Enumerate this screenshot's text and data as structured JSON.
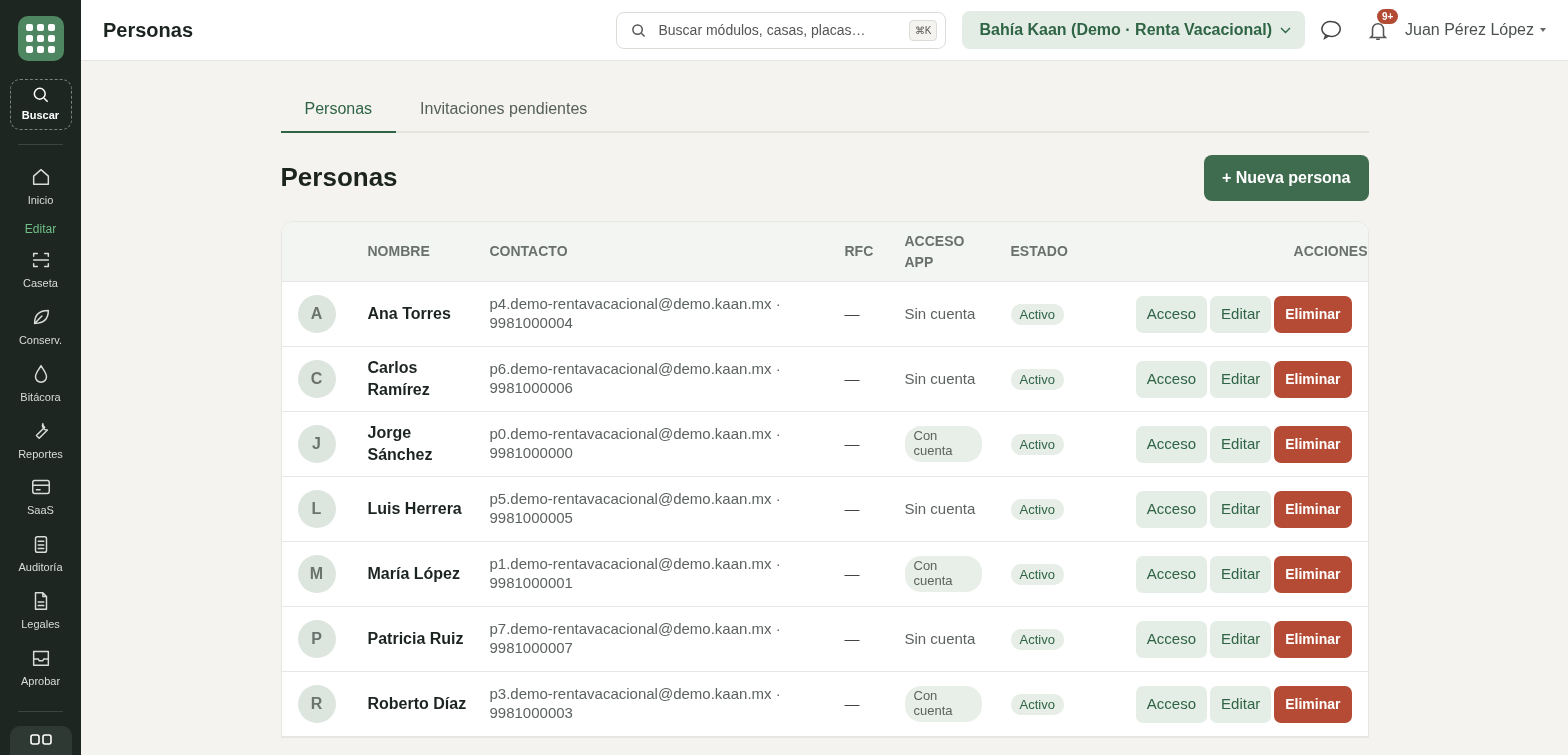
{
  "header": {
    "title": "Personas",
    "search": {
      "placeholder": "Buscar módulos, casas, placas…",
      "shortcut": "⌘K"
    },
    "workspace": "Bahía Kaan (Demo · Renta Vacacional)",
    "notifications": "9+",
    "user": "Juan Pérez López"
  },
  "sidebar": {
    "items": [
      {
        "kind": "search",
        "label": "Buscar",
        "selected": true
      },
      {
        "kind": "divider"
      },
      {
        "kind": "item",
        "label": "Inicio",
        "selected": false
      },
      {
        "kind": "section",
        "label": "Editar"
      },
      {
        "kind": "item",
        "label": "Caseta",
        "selected": false
      },
      {
        "kind": "item",
        "label": "Conserv.",
        "selected": false
      },
      {
        "kind": "item",
        "label": "Bitácora",
        "selected": false
      },
      {
        "kind": "item",
        "label": "Reportes",
        "selected": false
      },
      {
        "kind": "item",
        "label": "SaaS",
        "selected": false
      },
      {
        "kind": "item",
        "label": "Auditoría",
        "selected": false
      },
      {
        "kind": "item",
        "label": "Legales",
        "selected": false
      },
      {
        "kind": "item",
        "label": "Aprobar",
        "selected": false
      },
      {
        "kind": "divider"
      },
      {
        "kind": "more"
      }
    ]
  },
  "tabs": [
    {
      "label": "Personas",
      "selected": true
    },
    {
      "label": "Invitaciones pendientes",
      "selected": false
    }
  ],
  "page_title": "Personas",
  "new_button": "+ Nueva persona",
  "table": {
    "columns": [
      "",
      "NOMBRE",
      "CONTACTO",
      "RFC",
      "ACCESO APP",
      "ESTADO",
      "ACCIONES"
    ],
    "rows": [
      {
        "initial": "A",
        "name": "Ana Torres",
        "contact": "p4.demo-rentavacacional@demo.kaan.mx · 9981000004",
        "rfc": "—",
        "access": "Sin cuenta",
        "has_account": false,
        "status": "Activo",
        "actions": [
          "Acceso",
          "Editar",
          "Eliminar"
        ]
      },
      {
        "initial": "C",
        "name": "Carlos Ramírez",
        "contact": "p6.demo-rentavacacional@demo.kaan.mx · 9981000006",
        "rfc": "—",
        "access": "Sin cuenta",
        "has_account": false,
        "status": "Activo",
        "actions": [
          "Acceso",
          "Editar",
          "Eliminar"
        ]
      },
      {
        "initial": "J",
        "name": "Jorge Sánchez",
        "contact": "p0.demo-rentavacacional@demo.kaan.mx · 9981000000",
        "rfc": "—",
        "access": "Con cuenta",
        "has_account": true,
        "status": "Activo",
        "actions": [
          "Acceso",
          "Editar",
          "Eliminar"
        ]
      },
      {
        "initial": "L",
        "name": "Luis Herrera",
        "contact": "p5.demo-rentavacacional@demo.kaan.mx · 9981000005",
        "rfc": "—",
        "access": "Sin cuenta",
        "has_account": false,
        "status": "Activo",
        "actions": [
          "Acceso",
          "Editar",
          "Eliminar"
        ]
      },
      {
        "initial": "M",
        "name": "María López",
        "contact": "p1.demo-rentavacacional@demo.kaan.mx · 9981000001",
        "rfc": "—",
        "access": "Con cuenta",
        "has_account": true,
        "status": "Activo",
        "actions": [
          "Acceso",
          "Editar",
          "Eliminar"
        ]
      },
      {
        "initial": "P",
        "name": "Patricia Ruiz",
        "contact": "p7.demo-rentavacacional@demo.kaan.mx · 9981000007",
        "rfc": "—",
        "access": "Sin cuenta",
        "has_account": false,
        "status": "Activo",
        "actions": [
          "Acceso",
          "Editar",
          "Eliminar"
        ]
      },
      {
        "initial": "R",
        "name": "Roberto Díaz",
        "contact": "p3.demo-rentavacacional@demo.kaan.mx · 9981000003",
        "rfc": "—",
        "access": "Con cuenta",
        "has_account": true,
        "status": "Activo",
        "actions": [
          "Acceso",
          "Editar",
          "Eliminar"
        ]
      }
    ]
  }
}
